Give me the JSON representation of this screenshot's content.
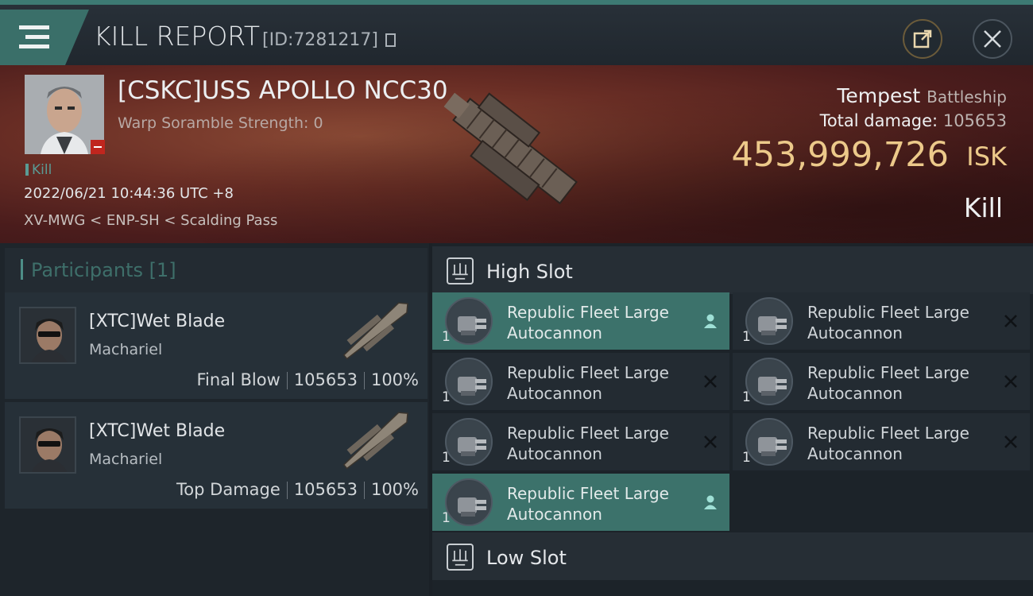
{
  "header": {
    "title": "KILL REPORT",
    "report_id": "[ID:7281217]",
    "share_icon": "share-icon",
    "close_icon": "close-icon",
    "accent": "#3d7a73"
  },
  "victim": {
    "name": "[CSKC]USS APOLLO NCC30",
    "warp_scramble": "Warp Soramble Strength: 0",
    "result_tag": "Kill",
    "datetime": "2022/06/21 10:44:36 UTC +8",
    "location": "XV-MWG < ENP-SH < Scalding Pass",
    "ship_name": "Tempest",
    "ship_class": "Battleship",
    "total_damage_label": "Total damage:",
    "total_damage": "105653",
    "isk_value": "453,999,726",
    "isk_unit": "ISK",
    "result": "Kill",
    "isk_color": "#ecc98a"
  },
  "participants": {
    "title": "Participants [1]",
    "rows": [
      {
        "name": "[XTC]Wet Blade",
        "ship": "Machariel",
        "label": "Final Blow",
        "damage": "105653",
        "percent": "100%"
      },
      {
        "name": "[XTC]Wet Blade",
        "ship": "Machariel",
        "label": "Top Damage",
        "damage": "105653",
        "percent": "100%"
      }
    ]
  },
  "fitting": {
    "high_slot": {
      "label": "High Slot",
      "modules": [
        {
          "name_line1": "Republic Fleet Large",
          "name_line2": "Autocannon",
          "qty": "1",
          "state": "pilot-icon",
          "highlighted": true
        },
        {
          "name_line1": "Republic Fleet Large",
          "name_line2": "Autocannon",
          "qty": "1",
          "state": "destroyed-icon",
          "highlighted": false
        },
        {
          "name_line1": "Republic Fleet Large",
          "name_line2": "Autocannon",
          "qty": "1",
          "state": "destroyed-icon",
          "highlighted": false
        },
        {
          "name_line1": "Republic Fleet Large",
          "name_line2": "Autocannon",
          "qty": "1",
          "state": "destroyed-icon",
          "highlighted": false
        },
        {
          "name_line1": "Republic Fleet Large",
          "name_line2": "Autocannon",
          "qty": "1",
          "state": "destroyed-icon",
          "highlighted": false
        },
        {
          "name_line1": "Republic Fleet Large",
          "name_line2": "Autocannon",
          "qty": "1",
          "state": "destroyed-icon",
          "highlighted": false
        },
        {
          "name_line1": "Republic Fleet Large",
          "name_line2": "Autocannon",
          "qty": "1",
          "state": "pilot-icon",
          "highlighted": true
        }
      ]
    },
    "low_slot": {
      "label": "Low Slot"
    }
  }
}
